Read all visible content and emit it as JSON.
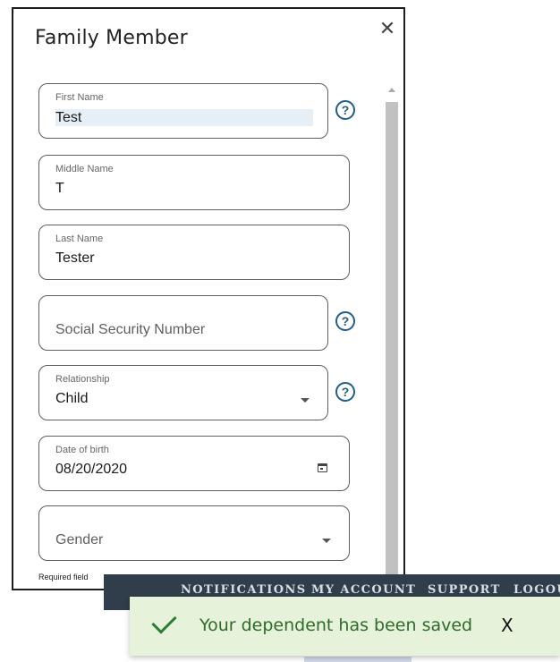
{
  "dialog": {
    "title": "Family Member",
    "close_icon": "✕",
    "fields": {
      "first_name": {
        "label": "First Name",
        "value": "Test"
      },
      "middle_name": {
        "label": "Middle Name",
        "value": "T"
      },
      "last_name": {
        "label": "Last Name",
        "value": "Tester"
      },
      "ssn": {
        "placeholder": "Social Security Number"
      },
      "relationship": {
        "label": "Relationship",
        "value": "Child"
      },
      "dob": {
        "label": "Date of birth",
        "value": "08/20/2020"
      },
      "gender": {
        "placeholder": "Gender"
      }
    },
    "help_symbol": "?",
    "required_note": "Required field"
  },
  "nav": {
    "items": [
      "NOTIFICATIONS",
      "MY ACCOUNT",
      "SUPPORT",
      "LOGOUT"
    ]
  },
  "toast": {
    "message": "Your dependent has been saved",
    "close_label": "X",
    "color": "#e6f3da"
  },
  "icons": {
    "help": "help-circle-icon",
    "calendar": "calendar-icon",
    "check": "check-icon",
    "close": "close-icon"
  }
}
